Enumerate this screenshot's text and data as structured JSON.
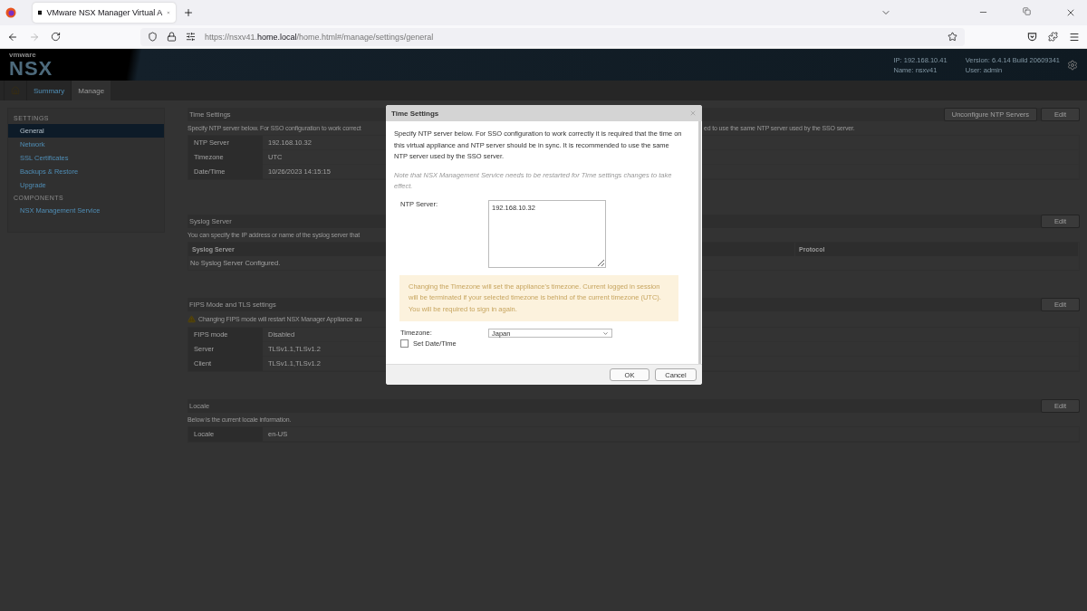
{
  "browser": {
    "tab_title": "VMware NSX Manager Virtual A",
    "url": "https://nsxv41.**home.local**/home.html#/manage/settings/general"
  },
  "header": {
    "logo_top": "vmware",
    "logo": "NSX",
    "info": [
      {
        "label": "IP:",
        "value": "192.168.10.41"
      },
      {
        "label": "Version:",
        "value": "6.4.14 Build 20609341"
      },
      {
        "label": "Name:",
        "value": "nsxv41"
      },
      {
        "label": "User:",
        "value": "admin"
      }
    ]
  },
  "nav_tabs": [
    {
      "label": "Summary",
      "selected": false
    },
    {
      "label": "Manage",
      "selected": true
    }
  ],
  "sidebar": [
    {
      "heading": "SETTINGS",
      "items": [
        {
          "label": "General",
          "selected": true
        },
        {
          "label": "Network",
          "selected": false
        },
        {
          "label": "SSL Certificates",
          "selected": false
        },
        {
          "label": "Backups & Restore",
          "selected": false
        },
        {
          "label": "Upgrade",
          "selected": false
        }
      ]
    },
    {
      "heading": "COMPONENTS",
      "items": [
        {
          "label": "NSX Management Service",
          "selected": false
        }
      ]
    }
  ],
  "sections": [
    {
      "kind": "properties",
      "title": "Time Settings",
      "buttons": [
        "Unconfigure NTP Servers",
        "Edit"
      ],
      "description": [
        "Specify NTP server below. For SSO configuration to work correct",
        "ed to use the same NTP server used by the SSO server."
      ],
      "rows": [
        {
          "label": "NTP Server",
          "value": "192.168.10.32"
        },
        {
          "label": "Timezone",
          "value": "UTC"
        },
        {
          "label": "Date/Time",
          "value": "10/26/2023 14:15:15"
        }
      ]
    },
    {
      "kind": "table",
      "title": "Syslog Server",
      "buttons": [
        "Edit"
      ],
      "description": [
        "You can specify the IP address or name of the syslog server that"
      ],
      "columns": [
        "Syslog Server",
        "Protocol"
      ],
      "empty": "No Syslog Server Configured."
    },
    {
      "kind": "properties",
      "title": "FIPS Mode and TLS settings",
      "buttons": [
        "Edit"
      ],
      "warning": "Changing FIPS mode will restart NSX Manager Appliance au",
      "rows": [
        {
          "label": "FIPS mode",
          "value": "Disabled"
        },
        {
          "label": "Server",
          "value": "TLSv1.1,TLSv1.2"
        },
        {
          "label": "Client",
          "value": "TLSv1.1,TLSv1.2"
        }
      ]
    },
    {
      "kind": "properties",
      "title": "Locale",
      "buttons": [
        "Edit"
      ],
      "description": [
        "Below is the current locale information."
      ],
      "rows": [
        {
          "label": "Locale",
          "value": "en-US"
        }
      ]
    }
  ],
  "dialog": {
    "title": "Time Settings",
    "intro": "Specify NTP server below. For SSO configuration to work correctly it is required that the time on this virtual appliance and NTP server should be in sync. It is recommended to use the same NTP server used by the SSO server.",
    "note": "Note that NSX Management Service needs to be restarted for Time settings changes to take effect.",
    "ntp_label": "NTP Server:",
    "ntp_value": "192.168.10.32",
    "warning": "Changing the Timezone will set the appliance's timezone. Current logged in session will be terminated if your selected timezone is behind of the current timezone (UTC). You will be required to sign in again.",
    "timezone_label": "Timezone:",
    "timezone": "Japan",
    "set_datetime": {
      "label": "Set Date/Time",
      "checked": false
    },
    "buttons": [
      "OK",
      "Cancel"
    ]
  }
}
